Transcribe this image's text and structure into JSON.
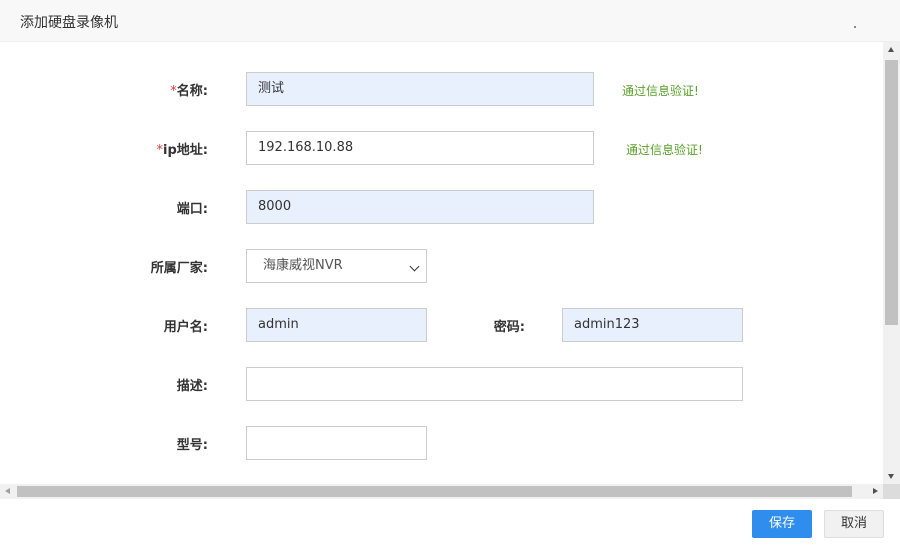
{
  "dialog": {
    "title": "添加硬盘录像机"
  },
  "form": {
    "name": {
      "required_mark": "*",
      "label": "名称:",
      "value": "测试",
      "validation": "通过信息验证!"
    },
    "ip": {
      "required_mark": "*",
      "label": "ip地址:",
      "value": "192.168.10.88",
      "validation": "通过信息验证!"
    },
    "port": {
      "label": "端口:",
      "value": "8000"
    },
    "vendor": {
      "label": "所属厂家:",
      "selected": "海康威视NVR"
    },
    "username": {
      "label": "用户名:",
      "value": "admin"
    },
    "password": {
      "label": "密码:",
      "value": "admin123"
    },
    "description": {
      "label": "描述:",
      "value": ""
    },
    "model": {
      "label": "型号:",
      "value": ""
    }
  },
  "footer": {
    "save_label": "保存",
    "cancel_label": "取消"
  },
  "colors": {
    "primary": "#2e8ded",
    "success": "#5aa02c",
    "required": "#e4393c",
    "autofill": "#e8f0fe"
  }
}
